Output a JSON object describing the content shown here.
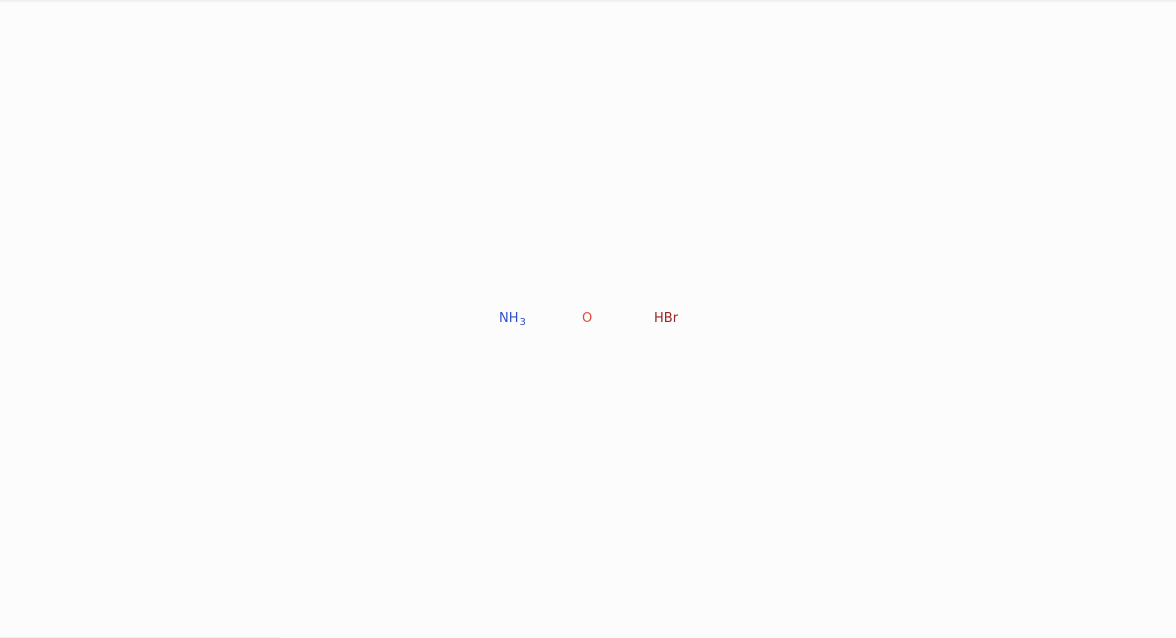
{
  "molecules": {
    "nh3": {
      "base": "NH",
      "subscript": "3",
      "color": "#3050c8"
    },
    "o": {
      "label": "O",
      "color": "#e04a3f"
    },
    "hbr": {
      "label": "HBr",
      "color": "#9b2424"
    }
  }
}
